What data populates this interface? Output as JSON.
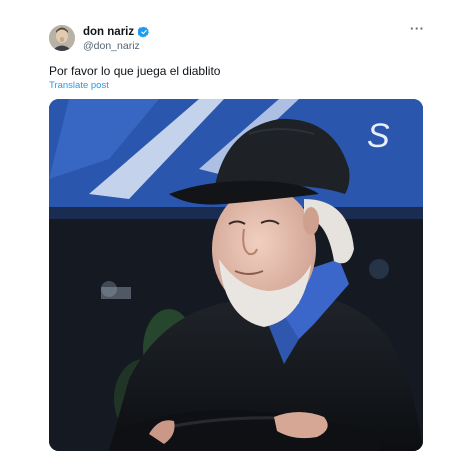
{
  "user": {
    "display_name": "don nariz",
    "handle": "@don_nariz",
    "verified": true,
    "avatar_icon": "avatar-photo"
  },
  "more_icon": "more-options-icon",
  "tweet": {
    "text": "Por favor lo que juega el diablito",
    "translate_label": "Translate post"
  },
  "media": {
    "description_icon": "video-frame",
    "banner_text": "S"
  },
  "colors": {
    "link": "#1d9bf0",
    "verified": "#1d9bf0",
    "text_primary": "#0f1419",
    "text_secondary": "#536471"
  }
}
